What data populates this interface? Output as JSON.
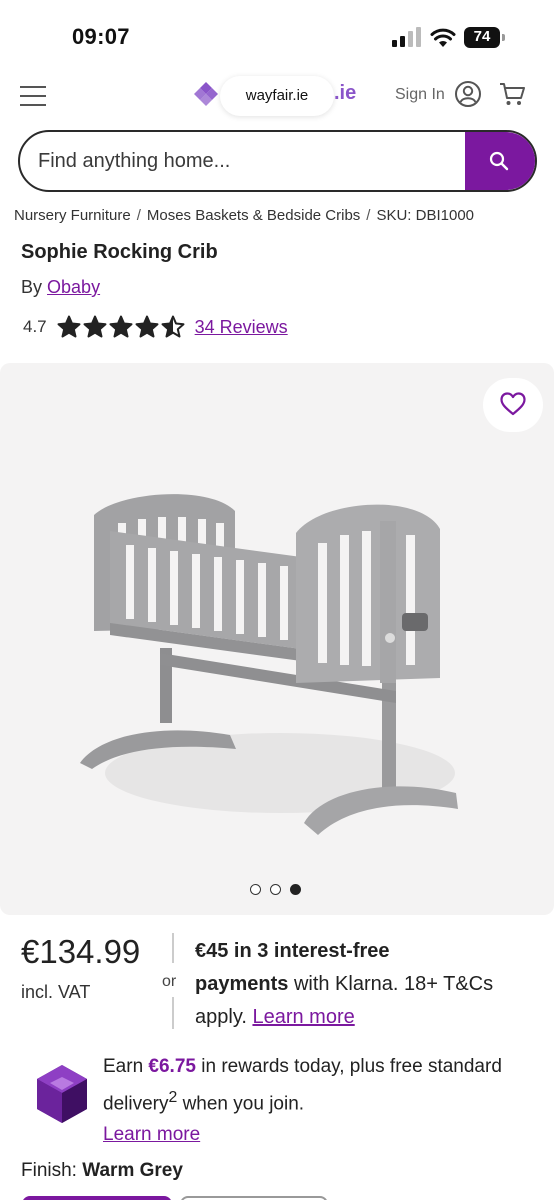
{
  "status_bar": {
    "time": "09:07",
    "battery": "74"
  },
  "header": {
    "url": "wayfair.ie",
    "logo_tail": ".ie",
    "sign_in": "Sign In",
    "icons": {
      "menu": "hamburger-icon",
      "user": "user-icon",
      "cart": "cart-icon"
    }
  },
  "search": {
    "placeholder": "Find anything home...",
    "icon": "search-icon"
  },
  "breadcrumb": {
    "items": [
      "Nursery Furniture",
      "Moses Baskets & Bedside Cribs"
    ],
    "sku": "SKU: DBI1000"
  },
  "product": {
    "title": "Sophie Rocking Crib",
    "by": "By",
    "brand": "Obaby",
    "rating": "4.7",
    "stars_value": 4.5,
    "reviews": "34 Reviews"
  },
  "gallery": {
    "image_count": 3,
    "active_index": 2,
    "favorite_icon": "heart-icon"
  },
  "price": {
    "amount": "€134.99",
    "vat": "incl. VAT",
    "or": "or",
    "klarna_bold_1": "€45 in 3 interest-free",
    "klarna_bold_2": "payments",
    "klarna_rest": "with Klarna. 18+ T&Cs apply.",
    "learn_more": "Learn more"
  },
  "rewards": {
    "earn": "Earn",
    "amount": "€6.75",
    "text_1": "in rewards today, plus free standard delivery",
    "superscript": "2",
    "text_2": "when you join.",
    "learn_more": "Learn more"
  },
  "finish": {
    "label": "Finish:",
    "value": "Warm Grey"
  },
  "colors": {
    "brand": "#7b189f",
    "accent_logo": "#8a55c9",
    "crib": "#a3a3a5"
  }
}
